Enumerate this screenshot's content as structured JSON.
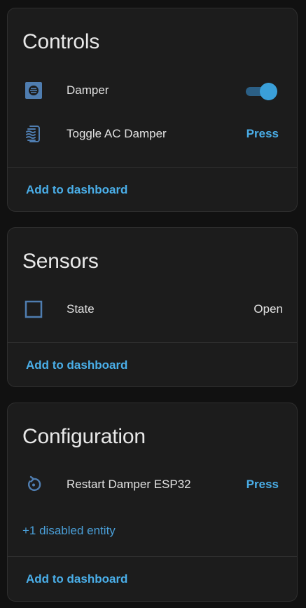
{
  "controls": {
    "title": "Controls",
    "items": [
      {
        "label": "Damper",
        "icon": "damper-icon",
        "control": "toggle",
        "state": "on"
      },
      {
        "label": "Toggle AC Damper",
        "icon": "ac-damper-icon",
        "action": "Press"
      }
    ],
    "footer": "Add to dashboard"
  },
  "sensors": {
    "title": "Sensors",
    "items": [
      {
        "label": "State",
        "icon": "square-outline-icon",
        "value": "Open"
      }
    ],
    "footer": "Add to dashboard"
  },
  "configuration": {
    "title": "Configuration",
    "items": [
      {
        "label": "Restart Damper ESP32",
        "icon": "restart-icon",
        "action": "Press"
      }
    ],
    "disabled_link": "+1 disabled entity",
    "footer": "Add to dashboard"
  },
  "colors": {
    "background": "#111111",
    "card": "#1c1c1c",
    "accent": "#4aaee8",
    "icon": "#4f7db0",
    "text": "#e1e1e1"
  }
}
